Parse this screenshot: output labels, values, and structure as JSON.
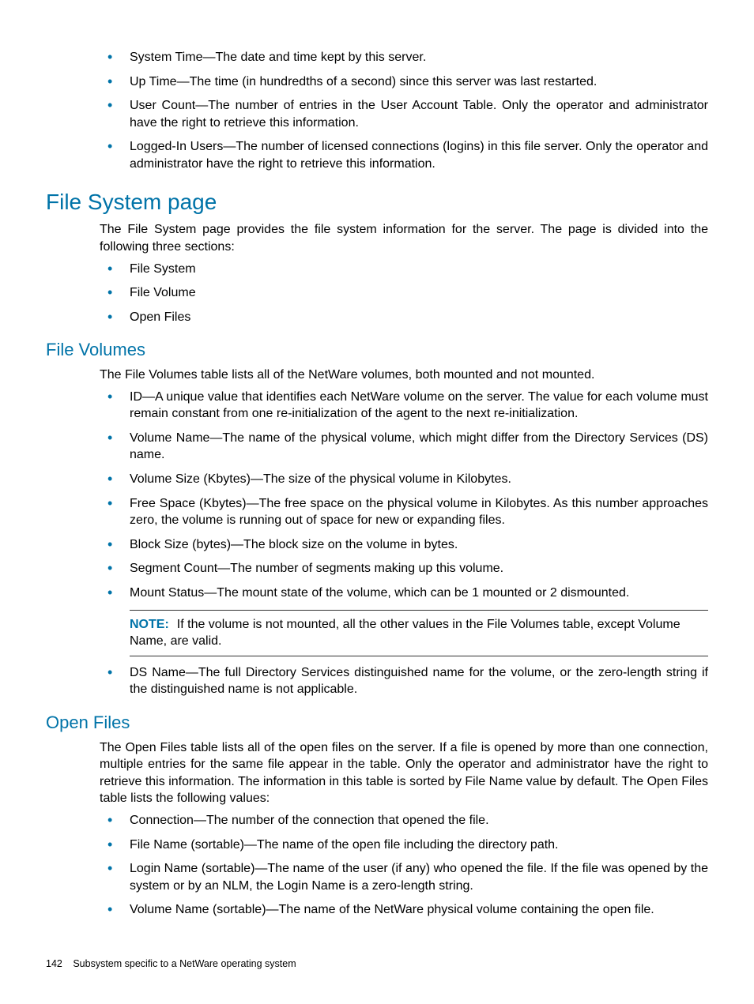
{
  "topList": [
    "System Time—The date and time kept by this server.",
    "Up Time—The time (in hundredths of a second) since this server was last restarted.",
    "User Count—The number of entries in the User Account Table. Only the operator and administrator have the right to retrieve this information.",
    "Logged-In Users—The number of licensed connections (logins) in this file server. Only the operator and administrator have the right to retrieve this information."
  ],
  "fileSystem": {
    "heading": "File System page",
    "intro": "The File System page provides the file system information for the server. The page is divided into the following three sections:",
    "items": [
      "File System",
      "File Volume",
      "Open Files"
    ]
  },
  "fileVolumes": {
    "heading": "File Volumes",
    "intro": "The File Volumes table lists all of the NetWare volumes, both mounted and not mounted.",
    "items1": [
      "ID—A unique value that identifies each NetWare volume on the server. The value for each volume must remain constant from one re-initialization of the agent to the next re-initialization.",
      "Volume Name—The name of the physical volume, which might differ from the Directory Services (DS) name.",
      "Volume Size (Kbytes)—The size of the physical volume in Kilobytes.",
      "Free Space (Kbytes)—The free space on the physical volume in Kilobytes. As this number approaches zero, the volume is running out of space for new or expanding files.",
      "Block Size (bytes)—The block size on the volume in bytes.",
      "Segment Count—The number of segments making up this volume.",
      "Mount Status—The mount state of the volume, which can be 1 mounted or 2 dismounted."
    ],
    "noteLabel": "NOTE:",
    "noteText": "If the volume is not mounted, all the other values in the File Volumes table, except Volume Name, are valid.",
    "items2": [
      "DS Name—The full Directory Services distinguished name for the volume, or the zero-length string if the distinguished name is not applicable."
    ]
  },
  "openFiles": {
    "heading": "Open Files",
    "intro": "The Open Files table lists all of the open files on the server. If a file is opened by more than one connection, multiple entries for the same file appear in the table. Only the operator and administrator have the right to retrieve this information. The information in this table is sorted by File Name value by default. The Open Files table lists the following values:",
    "items": [
      "Connection—The number of the connection that opened the file.",
      "File Name (sortable)—The name of the open file including the directory path.",
      "Login Name (sortable)—The name of the user (if any) who opened the file. If the file was opened by the system or by an NLM, the Login Name is a zero-length string.",
      "Volume Name (sortable)—The name of the NetWare physical volume containing the open file."
    ]
  },
  "footer": {
    "pageNumber": "142",
    "section": "Subsystem specific to a NetWare operating system"
  }
}
